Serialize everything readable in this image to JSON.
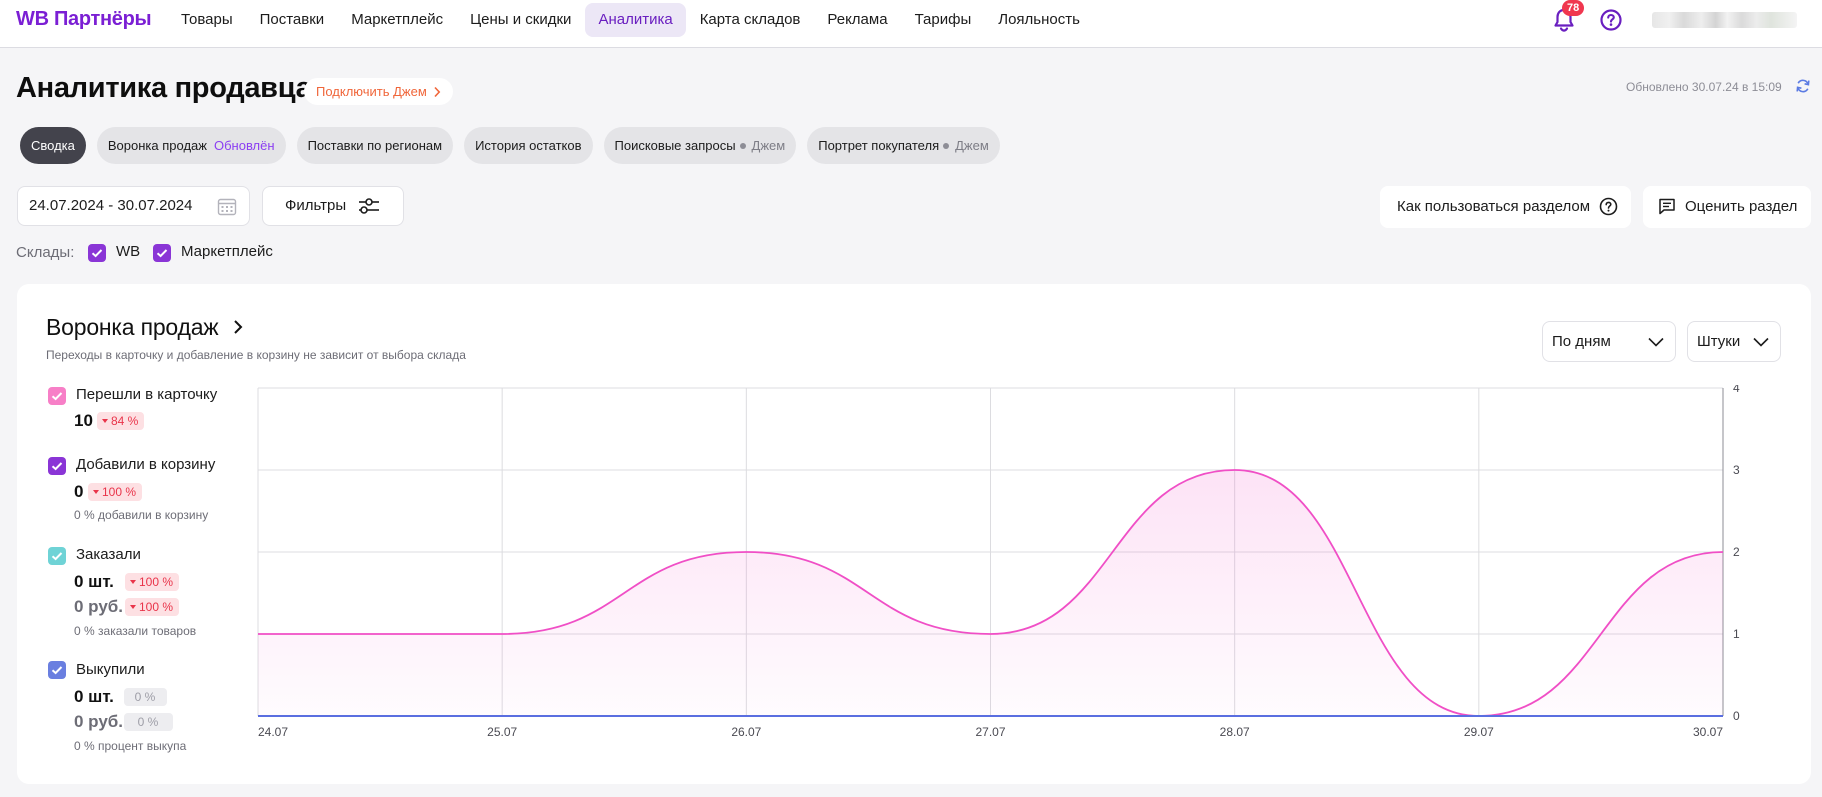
{
  "nav": {
    "logo": "WB Партнёры",
    "items": [
      {
        "label": "Товары"
      },
      {
        "label": "Поставки"
      },
      {
        "label": "Маркетплейс"
      },
      {
        "label": "Цены и скидки"
      },
      {
        "label": "Аналитика",
        "active": true
      },
      {
        "label": "Карта складов"
      },
      {
        "label": "Реклама"
      },
      {
        "label": "Тарифы"
      },
      {
        "label": "Лояльность"
      }
    ],
    "notifications_count": "78",
    "bell_icon": "bell-icon",
    "help_icon": "help-circle-icon"
  },
  "header": {
    "title": "Аналитика продавца",
    "jam_button": "Подключить Джем",
    "updated": "Обновлено 30.07.24 в 15:09",
    "refresh_icon": "refresh-icon"
  },
  "tabs": [
    {
      "label": "Сводка",
      "active": true
    },
    {
      "label": "Воронка продаж",
      "sub": "Обновлён"
    },
    {
      "label": "Поставки по регионам"
    },
    {
      "label": "История остатков"
    },
    {
      "label": "Поисковые запросы",
      "jam": "Джем"
    },
    {
      "label": "Портрет покупателя",
      "jam": "Джем"
    }
  ],
  "controls": {
    "date_range": "24.07.2024 - 30.07.2024",
    "filters_label": "Фильтры",
    "howto_label": "Как пользоваться разделом",
    "rate_label": "Оценить раздел",
    "warehouses_label": "Склады:",
    "warehouses": [
      {
        "label": "WB",
        "checked": true
      },
      {
        "label": "Маркетплейс",
        "checked": true
      }
    ]
  },
  "funnel": {
    "title": "Воронка продаж",
    "subtitle": "Переходы в карточку и добавление в корзину не зависит от выбора склада",
    "period_select": "По дням",
    "unit_select": "Штуки",
    "metrics": [
      {
        "label": "Перешли в карточку",
        "value": "10",
        "delta": "84 %",
        "color": "#f77fc7"
      },
      {
        "label": "Добавили в корзину",
        "value": "0",
        "delta": "100 %",
        "note": "0 % добавили в корзину",
        "color": "#8a35d6"
      },
      {
        "label": "Заказали",
        "value": "0 шт.",
        "delta": "100 %",
        "value2": "0 руб.",
        "delta2": "100 %",
        "note": "0 % заказали товаров",
        "color": "#6fd3d6"
      },
      {
        "label": "Выкупили",
        "value": "0 шт.",
        "delta": "0 %",
        "value2": "0 руб.",
        "delta2": "0 %",
        "note": "0 % процент выкупа",
        "color": "#6a7fe0"
      }
    ]
  },
  "chart_data": {
    "type": "line",
    "title": "",
    "xlabel": "",
    "ylabel": "",
    "categories": [
      "24.07",
      "25.07",
      "26.07",
      "27.07",
      "28.07",
      "29.07",
      "30.07"
    ],
    "yticks": [
      0,
      1,
      2,
      3,
      4
    ],
    "ylim": [
      0,
      4
    ],
    "grid": true,
    "y_axis_position": "right",
    "series": [
      {
        "values": [
          1,
          1,
          2,
          1,
          3,
          0,
          2
        ],
        "color": "#f04fc6"
      },
      {
        "values": [
          0,
          0,
          0,
          0,
          0,
          0,
          0
        ],
        "color": "#5a6ee0"
      }
    ]
  }
}
